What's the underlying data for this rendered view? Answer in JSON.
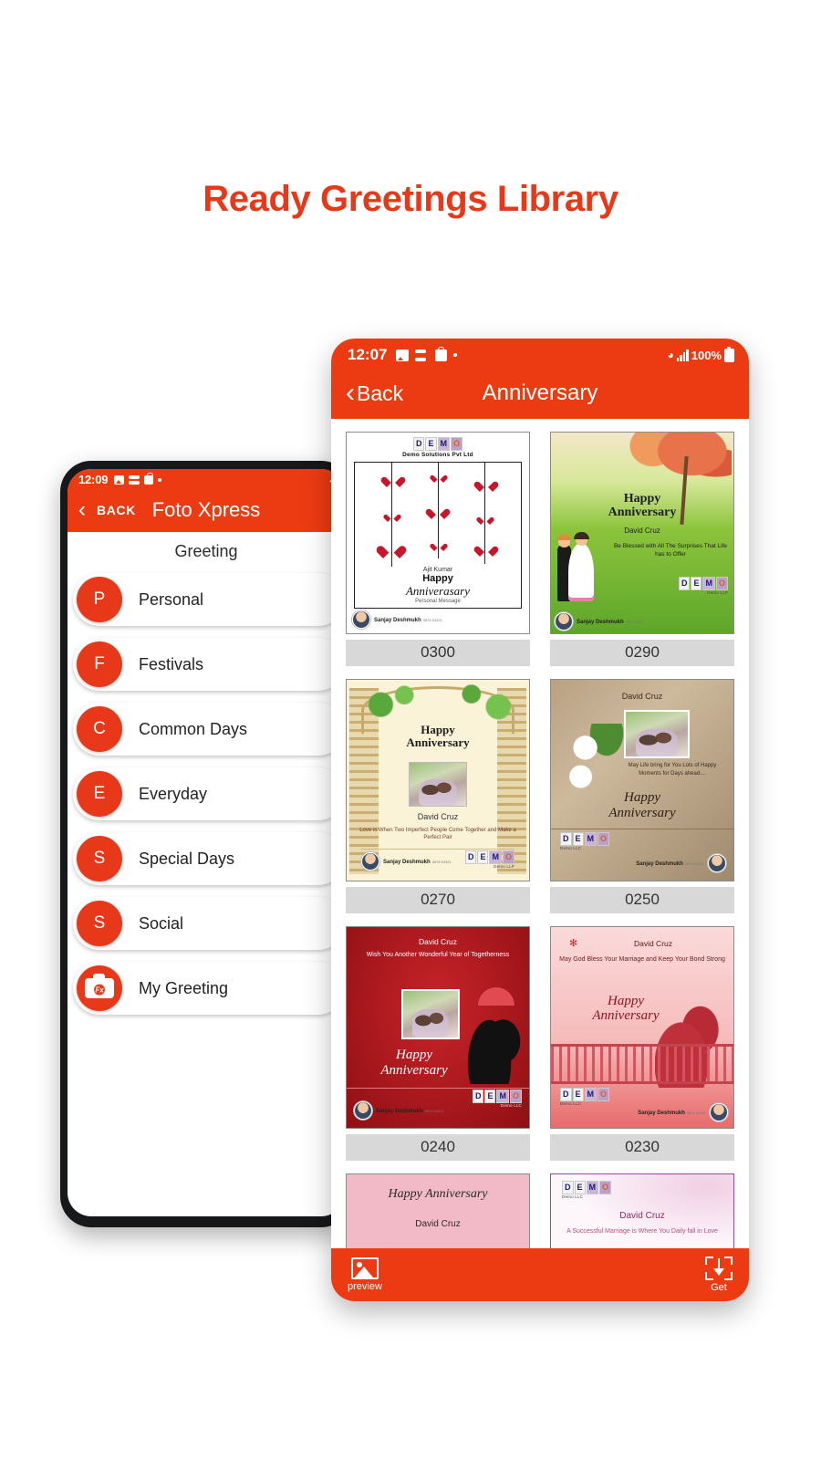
{
  "headline": "Ready Greetings Library",
  "theme": {
    "accent": "#ec3b12",
    "headline_color": "#e8381a",
    "caption_bg": "#d8d8d8"
  },
  "back_phone": {
    "status": {
      "time": "12:09",
      "icons": [
        "photo-icon",
        "stack-icon",
        "bag-icon",
        "dot-icon"
      ],
      "wifi": "wifi-icon"
    },
    "header": {
      "back_label": "BACK",
      "title": "Foto Xpress",
      "chevron": "‹"
    },
    "subtitle": "Greeting",
    "items": [
      {
        "initial": "P",
        "label": "Personal"
      },
      {
        "initial": "F",
        "label": "Festivals"
      },
      {
        "initial": "C",
        "label": "Common Days"
      },
      {
        "initial": "E",
        "label": "Everyday"
      },
      {
        "initial": "S",
        "label": "Special Days"
      },
      {
        "initial": "S",
        "label": "Social"
      },
      {
        "initial": "Fx",
        "label": "My Greeting"
      }
    ]
  },
  "front_phone": {
    "status": {
      "time": "12:07",
      "battery": "100%",
      "icons": [
        "photo-icon",
        "stack-icon",
        "bag-icon",
        "dot-icon"
      ]
    },
    "header": {
      "back_label": "Back",
      "title": "Anniversary",
      "chevron": "‹"
    },
    "cards": [
      {
        "id": "0300",
        "brand": "DEMO",
        "org": "Demo Solutions Pvt Ltd",
        "name": "Ajit Kumar",
        "greeting_line1": "Happy",
        "greeting_line2": "Anniverasary",
        "message": "Personal Message",
        "person_name": "Sanjay Deshmukh",
        "person_meta": "9876 54321"
      },
      {
        "id": "0290",
        "brand": "DEMO",
        "brand_sub": "Demo LLP",
        "greeting_line1": "Happy",
        "greeting_line2": "Anniversary",
        "name": "David Cruz",
        "message": "Be Blessed with All The Surprises That Life has to Offer",
        "person_name": "Sanjay Deshmukh",
        "person_meta": "9876 54321"
      },
      {
        "id": "0270",
        "brand": "DEMO",
        "brand_sub": "Demo LLP",
        "greeting_line1": "Happy",
        "greeting_line2": "Anniversary",
        "name": "David Cruz",
        "message": "Love is When Two Imperfect People Come Together and Make a Perfect Pair",
        "person_name": "Sanjay Deshmukh",
        "person_meta": "9876 54321"
      },
      {
        "id": "0250",
        "brand": "DEMO",
        "brand_sub": "Demo LLC",
        "name": "David Cruz",
        "message": "May Life bring for You Lots of Happy Moments for Days ahead....",
        "greeting_line1": "Happy",
        "greeting_line2": "Anniversary",
        "person_name": "Sanjay Deshmukh",
        "person_meta": "9876 54321"
      },
      {
        "id": "0240",
        "brand": "DEMO",
        "brand_sub": "Demo LLC",
        "name": "David Cruz",
        "message": "Wish You Another Wonderful Year of Togetherness",
        "greeting_line1": "Happy",
        "greeting_line2": "Anniversary",
        "person_name": "Sanjay Deshmukh",
        "person_meta": "9876 54321"
      },
      {
        "id": "0230",
        "brand": "DEMO",
        "brand_sub": "Demo LLC",
        "name": "David Cruz",
        "message": "May God Bless Your Marriage and Keep Your Bond Strong",
        "greeting_line1": "Happy",
        "greeting_line2": "Anniversary",
        "person_name": "Sanjay Deshmukh",
        "person_meta": "9876 54321"
      }
    ],
    "partial_cards": [
      {
        "greeting": "Happy Anniversary",
        "name": "David Cruz"
      },
      {
        "brand": "DEMO",
        "brand_sub": "Demo LLC",
        "name": "David Cruz",
        "message": "A Successful Marriage is Where You Daily fall in Love"
      }
    ],
    "bottom_bar": {
      "preview_label": "preview",
      "get_label": "Get"
    }
  }
}
